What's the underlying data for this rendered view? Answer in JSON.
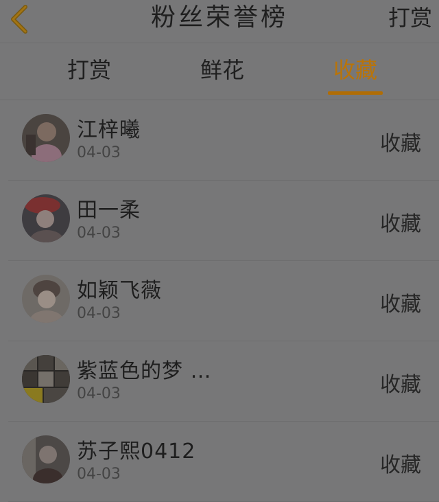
{
  "header": {
    "title": "粉丝荣誉榜",
    "right_link": "打赏",
    "back_icon": "chevron-left-icon",
    "accent_color": "#b97409"
  },
  "tabs": [
    {
      "label": "打赏",
      "active": false
    },
    {
      "label": "鲜花",
      "active": false
    },
    {
      "label": "收藏",
      "active": true
    }
  ],
  "list": [
    {
      "name": "江梓曦",
      "date": "04-03",
      "action": "收藏"
    },
    {
      "name": "田一柔",
      "date": "04-03",
      "action": "收藏"
    },
    {
      "name": "如颖飞薇",
      "date": "04-03",
      "action": "收藏"
    },
    {
      "name": "紫蓝色的梦 …",
      "date": "04-03",
      "action": "收藏"
    },
    {
      "name": "苏子熙0412",
      "date": "04-03",
      "action": "收藏"
    }
  ]
}
